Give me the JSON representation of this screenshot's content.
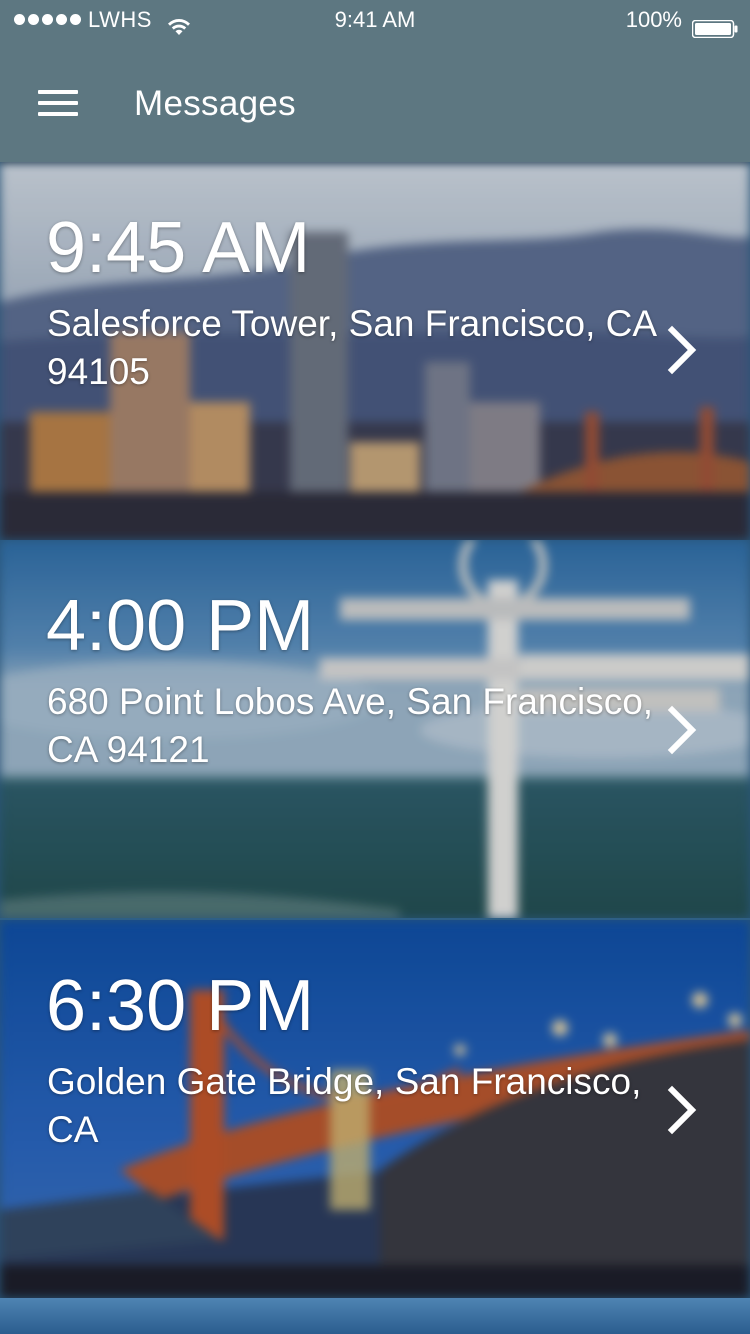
{
  "status_bar": {
    "carrier": "LWHS",
    "time": "9:41 AM",
    "battery": "100%",
    "icons": [
      "signal-dots-icon",
      "wifi-icon",
      "battery-icon"
    ]
  },
  "header": {
    "title": "Messages",
    "menu_icon": "hamburger-menu-icon"
  },
  "messages": [
    {
      "time": "9:45 AM",
      "address": "Salesforce Tower, San Francisco, CA 94105",
      "image": "san-francisco-skyline"
    },
    {
      "time": "4:00 PM",
      "address": "680 Point Lobos Ave, San Francisco, CA 94121",
      "image": "ocean-signpost"
    },
    {
      "time": "6:30 PM",
      "address": "Golden Gate Bridge, San Francisco, CA",
      "image": "golden-gate-bridge-dusk"
    }
  ],
  "colors": {
    "header_bg": "#5d7781",
    "text": "#ffffff"
  }
}
